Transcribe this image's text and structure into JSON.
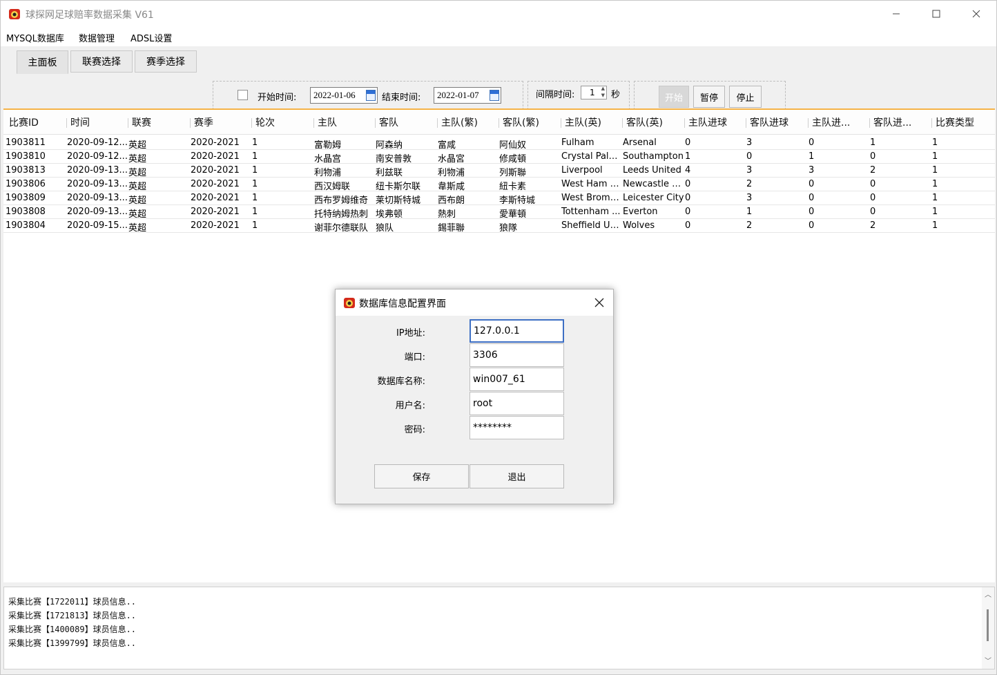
{
  "window": {
    "title": "球探网足球赔率数据采集 V61"
  },
  "menu": [
    "MYSQL数据库",
    "数据管理",
    "ADSL设置"
  ],
  "tabs": [
    "主面板",
    "联赛选择",
    "赛季选择"
  ],
  "toolbar": {
    "start_time_label": "开始时间:",
    "start_date": "2022-01-06",
    "end_time_label": "结束时间:",
    "end_date": "2022-01-07",
    "interval_label": "间隔时间:",
    "interval_value": "1",
    "interval_unit": "秒",
    "start_button": "开始",
    "pause_button": "暂停",
    "stop_button": "停止"
  },
  "table": {
    "columns": [
      "比赛ID",
      "时间",
      "联赛",
      "赛季",
      "轮次",
      "主队",
      "客队",
      "主队(繁)",
      "客队(繁)",
      "主队(英)",
      "客队(英)",
      "主队进球",
      "客队进球",
      "主队进...",
      "客队进...",
      "比赛类型"
    ],
    "rows": [
      [
        "1903811",
        "2020-09-12...",
        "英超",
        "2020-2021",
        "1",
        "富勒姆",
        "阿森纳",
        "富咸",
        "阿仙奴",
        "Fulham",
        "Arsenal",
        "0",
        "3",
        "0",
        "1",
        "1"
      ],
      [
        "1903810",
        "2020-09-12...",
        "英超",
        "2020-2021",
        "1",
        "水晶宫",
        "南安普敦",
        "水晶宮",
        "修咸頓",
        "Crystal Palace",
        "Southampton",
        "1",
        "0",
        "1",
        "0",
        "1"
      ],
      [
        "1903813",
        "2020-09-13...",
        "英超",
        "2020-2021",
        "1",
        "利物浦",
        "利兹联",
        "利物浦",
        "列斯聯",
        "Liverpool",
        "Leeds United",
        "4",
        "3",
        "3",
        "2",
        "1"
      ],
      [
        "1903806",
        "2020-09-13...",
        "英超",
        "2020-2021",
        "1",
        "西汉姆联",
        "纽卡斯尔联",
        "韋斯咸",
        "紐卡素",
        "West Ham U...",
        "Newcastle U...",
        "0",
        "2",
        "0",
        "0",
        "1"
      ],
      [
        "1903809",
        "2020-09-13...",
        "英超",
        "2020-2021",
        "1",
        "西布罗姆维奇",
        "莱切斯特城",
        "西布朗",
        "李斯特城",
        "West Bromw...",
        "Leicester City",
        "0",
        "3",
        "0",
        "0",
        "1"
      ],
      [
        "1903808",
        "2020-09-13...",
        "英超",
        "2020-2021",
        "1",
        "托特纳姆热刺",
        "埃弗顿",
        "熱刺",
        "愛華頓",
        "Tottenham ...",
        "Everton",
        "0",
        "1",
        "0",
        "0",
        "1"
      ],
      [
        "1903804",
        "2020-09-15...",
        "英超",
        "2020-2021",
        "1",
        "谢菲尔德联队",
        "狼队",
        "錫菲聯",
        "狼隊",
        "Sheffield Un...",
        "Wolves",
        "0",
        "2",
        "0",
        "2",
        "1"
      ]
    ]
  },
  "log": [
    "采集比赛【1722011】球员信息..",
    "采集比赛【1721813】球员信息..",
    "采集比赛【1400089】球员信息..",
    "采集比赛【1399799】球员信息.."
  ],
  "dialog": {
    "title": "数据库信息配置界面",
    "ip_label": "IP地址:",
    "ip_value": "127.0.0.1",
    "port_label": "端口:",
    "port_value": "3306",
    "db_label": "数据库名称:",
    "db_value": "win007_61",
    "user_label": "用户名:",
    "user_value": "root",
    "password_label": "密码:",
    "password_value": "********",
    "save_button": "保存",
    "exit_button": "退出"
  }
}
